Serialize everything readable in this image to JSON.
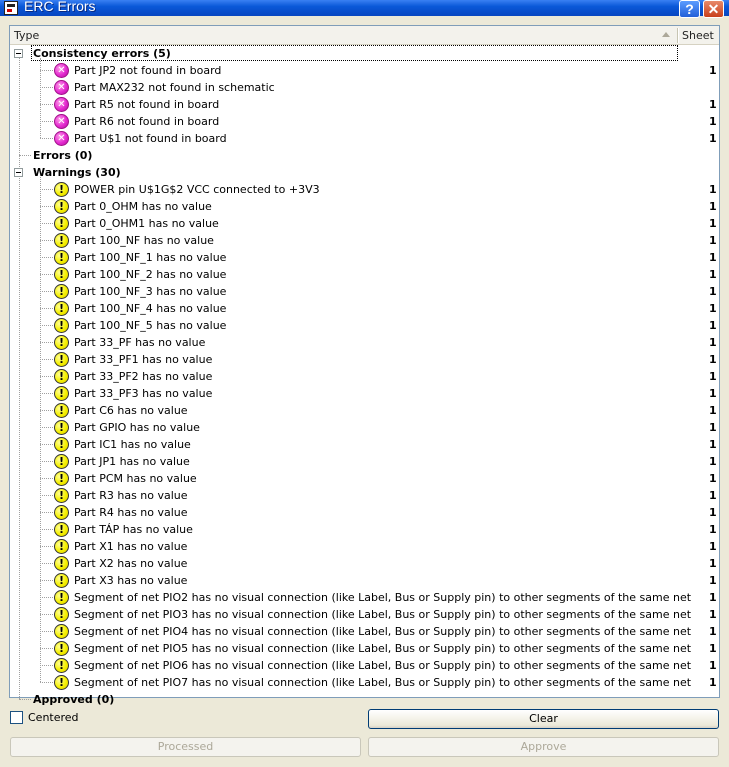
{
  "window": {
    "title": "ERC Errors",
    "help": "?",
    "close": "✕"
  },
  "header": {
    "type": "Type",
    "sheet": "Sheet"
  },
  "groups": {
    "consistency": {
      "label": "Consistency errors (5)",
      "items": [
        {
          "label": "Part JP2 not found in board",
          "sheet": "1"
        },
        {
          "label": "Part MAX232 not found in schematic",
          "sheet": ""
        },
        {
          "label": "Part R5 not found in board",
          "sheet": "1"
        },
        {
          "label": "Part R6 not found in board",
          "sheet": "1"
        },
        {
          "label": "Part U$1 not found in board",
          "sheet": "1"
        }
      ]
    },
    "errors": {
      "label": "Errors (0)"
    },
    "warnings": {
      "label": "Warnings (30)",
      "items": [
        {
          "label": "POWER pin U$1G$2 VCC connected to +3V3",
          "sheet": "1"
        },
        {
          "label": "Part 0_OHM has no value",
          "sheet": "1"
        },
        {
          "label": "Part 0_OHM1 has no value",
          "sheet": "1"
        },
        {
          "label": "Part 100_NF has no value",
          "sheet": "1"
        },
        {
          "label": "Part 100_NF_1 has no value",
          "sheet": "1"
        },
        {
          "label": "Part 100_NF_2 has no value",
          "sheet": "1"
        },
        {
          "label": "Part 100_NF_3 has no value",
          "sheet": "1"
        },
        {
          "label": "Part 100_NF_4 has no value",
          "sheet": "1"
        },
        {
          "label": "Part 100_NF_5 has no value",
          "sheet": "1"
        },
        {
          "label": "Part 33_PF has no value",
          "sheet": "1"
        },
        {
          "label": "Part 33_PF1 has no value",
          "sheet": "1"
        },
        {
          "label": "Part 33_PF2 has no value",
          "sheet": "1"
        },
        {
          "label": "Part 33_PF3 has no value",
          "sheet": "1"
        },
        {
          "label": "Part C6 has no value",
          "sheet": "1"
        },
        {
          "label": "Part GPIO has no value",
          "sheet": "1"
        },
        {
          "label": "Part IC1 has no value",
          "sheet": "1"
        },
        {
          "label": "Part JP1 has no value",
          "sheet": "1"
        },
        {
          "label": "Part PCM has no value",
          "sheet": "1"
        },
        {
          "label": "Part R3 has no value",
          "sheet": "1"
        },
        {
          "label": "Part R4 has no value",
          "sheet": "1"
        },
        {
          "label": "Part TÁP has no value",
          "sheet": "1"
        },
        {
          "label": "Part X1 has no value",
          "sheet": "1"
        },
        {
          "label": "Part X2 has no value",
          "sheet": "1"
        },
        {
          "label": "Part X3 has no value",
          "sheet": "1"
        },
        {
          "label": "Segment of net PIO2 has no visual connection (like Label, Bus or Supply pin) to other segments of the same net",
          "sheet": "1"
        },
        {
          "label": "Segment of net PIO3 has no visual connection (like Label, Bus or Supply pin) to other segments of the same net",
          "sheet": "1"
        },
        {
          "label": "Segment of net PIO4 has no visual connection (like Label, Bus or Supply pin) to other segments of the same net",
          "sheet": "1"
        },
        {
          "label": "Segment of net PIO5 has no visual connection (like Label, Bus or Supply pin) to other segments of the same net",
          "sheet": "1"
        },
        {
          "label": "Segment of net PIO6 has no visual connection (like Label, Bus or Supply pin) to other segments of the same net",
          "sheet": "1"
        },
        {
          "label": "Segment of net PIO7 has no visual connection (like Label, Bus or Supply pin) to other segments of the same net",
          "sheet": "1"
        }
      ]
    },
    "approved": {
      "label": "Approved (0)"
    }
  },
  "controls": {
    "centered": {
      "label": "Centered",
      "checked": false
    },
    "clear": "Clear",
    "processed": "Processed",
    "approve": "Approve"
  },
  "icons": {
    "error": "error-x-icon",
    "warning": "warning-exclamation-icon"
  },
  "colors": {
    "error_icon": "#e42ad0",
    "warning_icon": "#f5f000",
    "title_bar": "#0a58d8"
  }
}
